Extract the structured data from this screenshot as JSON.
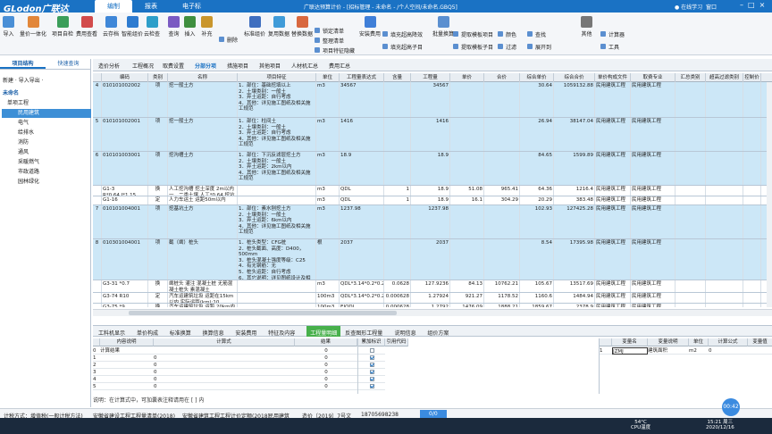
{
  "app": {
    "logo": "GLodon广联达",
    "window_title": "广联达预算计价 - [招标管理 - 未命名 - /个人空间/未命名.GBQ5]",
    "menu_tabs": [
      "编制",
      "报表",
      "电子标"
    ],
    "online_learning": "在线学习",
    "window_label": "窗口"
  },
  "ribbon": {
    "large_buttons": [
      "导入",
      "量价一体化",
      "项目自检",
      "费用查看",
      "云存档",
      "智能组价",
      "云检查",
      "查询",
      "插入",
      "补充",
      "标准组价",
      "复用数据",
      "替换数据",
      "安装费用",
      "批量换算",
      "其他",
      "工具"
    ],
    "small_buttons": [
      "删除",
      "锁定清单",
      "整理清单",
      "项目特征隐藏",
      "填充超高降效",
      "填充超高子目",
      "提取模板项目",
      "提取模板子目",
      "颜色",
      "查找",
      "过滤",
      "展开到",
      "计算器"
    ],
    "sub_menu": "标准组价"
  },
  "left_panel": {
    "tabs": [
      "项目结构",
      "快速查询"
    ],
    "toolbar": "新建 · 导入导出 ·",
    "tree": [
      "未命名",
      "单项工程",
      "民用建筑",
      "电气",
      "给排水",
      "消防",
      "通风",
      "采暖燃气",
      "市政道路",
      "园林绿化"
    ]
  },
  "main_tabs": [
    "造价分析",
    "工程概况",
    "取费设置",
    "分部分项",
    "措施项目",
    "其他项目",
    "人材机汇总",
    "费用汇总"
  ],
  "grid": {
    "headers": [
      "",
      "编码",
      "类别",
      "名称",
      "项目特征",
      "单位",
      "工程量表达式",
      "含量",
      "工程量",
      "单价",
      "合价",
      "综合单价",
      "综合合价",
      "单价构成文件",
      "取费专业",
      "汇总类别",
      "超高过滤类别",
      "控制价"
    ],
    "rows": [
      {
        "no": "4",
        "code": "010101002002",
        "type": "项",
        "name": "挖一般土方",
        "feature": "1．部位：基础挖填以上\n2．土壤类别：一般土\n3．弃土运距：自行考虑\n4．其他：详见施工图纸及相关施工规范",
        "unit": "m3",
        "expr": "34567",
        "content": "",
        "qty": "34567",
        "price": "",
        "total": "",
        "comp_price": "30.64",
        "comp_total": "1059132.88",
        "file": "民用建筑工程",
        "prof": "民用建筑工程",
        "hl": true
      },
      {
        "no": "5",
        "code": "010101002001",
        "type": "项",
        "name": "挖一般土方",
        "feature": "1．部位：柱间土\n2．土壤类别：一般土\n3．弃土运距：自行考虑\n4．其他：详见施工图纸及相关施工规范",
        "unit": "m3",
        "expr": "1416",
        "content": "",
        "qty": "1416",
        "price": "",
        "total": "",
        "comp_price": "26.94",
        "comp_total": "38147.04",
        "file": "民用建筑工程",
        "prof": "民用建筑工程",
        "hl": true
      },
      {
        "no": "6",
        "code": "010101003001",
        "type": "项",
        "name": "挖沟槽土方",
        "feature": "1．部位：下沉反滤层挖土方\n2．土壤类别：一般土\n3．弃土运距：2km以内\n4．其他：详见施工图纸及相关施工规范",
        "unit": "m3",
        "expr": "18.9",
        "content": "",
        "qty": "18.9",
        "price": "",
        "total": "",
        "comp_price": "84.65",
        "comp_total": "1599.89",
        "file": "民用建筑工程",
        "prof": "民用建筑工程",
        "hl": true
      },
      {
        "no": "",
        "code": "G1-3\nR*0.64,J*1.15",
        "type": "换",
        "name": "人工挖沟槽 挖土深度 2m以内 一、二类土壤 人工*0.64 挖坑槽土方 人工*1.5",
        "feature": "",
        "unit": "m3",
        "expr": "QDL",
        "content": "1",
        "qty": "18.9",
        "price": "51.08",
        "total": "965.41",
        "comp_price": "64.36",
        "comp_total": "1216.4",
        "file": "民用建筑工程",
        "prof": "民用建筑工程",
        "hl": false
      },
      {
        "no": "",
        "code": "G1-16",
        "type": "定",
        "name": "人力车运土 运距50m以内",
        "feature": "",
        "unit": "m3",
        "expr": "QDL",
        "content": "1",
        "qty": "18.9",
        "price": "16.1",
        "total": "304.29",
        "comp_price": "20.29",
        "comp_total": "383.48",
        "file": "民用建筑工程",
        "prof": "民用建筑工程",
        "hl": false
      },
      {
        "no": "7",
        "code": "010101004001",
        "type": "项",
        "name": "挖基坑土方",
        "feature": "1．部位：素水刨挖土方\n2．土壤类别：一般土\n3．弃土运距：6km以内\n4．其他：详见施工图纸及相关施工规范",
        "unit": "m3",
        "expr": "1237.98",
        "content": "",
        "qty": "1237.98",
        "price": "",
        "total": "",
        "comp_price": "102.93",
        "comp_total": "127425.28",
        "file": "民用建筑工程",
        "prof": "民用建筑工程",
        "hl": true
      },
      {
        "no": "8",
        "code": "010301004001",
        "type": "项",
        "name": "截（凿）桩头",
        "feature": "1．桩头类型：CFG桩\n2．桩头截面、高度：D400，500mm\n3．桩头混凝土强度等级：C25\n4．有无钢筋：无\n5．桩头运距：自行考虑\n6．其它说明：详见图纸设计及相关规范要求",
        "unit": "根",
        "expr": "2037",
        "content": "",
        "qty": "2037",
        "price": "",
        "total": "",
        "comp_price": "8.54",
        "comp_total": "17395.98",
        "file": "民用建筑工程",
        "prof": "民用建筑工程",
        "hl": true
      },
      {
        "no": "",
        "code": "G3-31 *0.7",
        "type": "换",
        "name": "凿桩头 灌注 混凝土桩 无筋混凝土桩头 素混凝土",
        "feature": "",
        "unit": "m3",
        "expr": "QDL*3.14*0.2*0.2*0.5",
        "content": "0.0628",
        "qty": "127.9236",
        "price": "84.13",
        "total": "10762.21",
        "comp_price": "105.67",
        "comp_total": "13517.69",
        "file": "民用建筑工程",
        "prof": "民用建筑工程",
        "hl": false
      },
      {
        "no": "",
        "code": "G3-74 R10",
        "type": "定",
        "name": "汽车运建筑垃圾 运距在15km以内 实际运距(km):10",
        "feature": "",
        "unit": "100m3",
        "expr": "QDL*3.14*0.2*0.2*0.5",
        "content": "0.000628",
        "qty": "1.27924",
        "price": "921.27",
        "total": "1178.52",
        "comp_price": "1160.6",
        "comp_total": "1484.94",
        "file": "民用建筑工程",
        "prof": "民用建筑工程",
        "hl": false
      },
      {
        "no": "",
        "code": "G3-75 *9",
        "type": "换",
        "name": "汽车运建筑垃圾 运距 20km内每增加运1km",
        "feature": "",
        "unit": "100m3",
        "expr": "EJQDL",
        "content": "0.000628",
        "qty": "1.2792",
        "price": "1476.09",
        "total": "1888.21",
        "comp_price": "1859.67",
        "comp_total": "2378.9",
        "file": "民用建筑工程",
        "prof": "民用建筑工程",
        "hl": false
      }
    ]
  },
  "bottom_tabs": [
    "工料机显示",
    "单价构成",
    "标准换算",
    "换算信息",
    "安装费用",
    "特征及内容",
    "工程量明细",
    "反查图形工程量",
    "说明信息",
    "组价方案"
  ],
  "bottom_active": "工程量明细",
  "detail_grid": {
    "headers": [
      "",
      "内容说明",
      "计算式",
      "结果",
      "累加标识",
      "引用代码"
    ],
    "rows": [
      {
        "idx": "0",
        "desc": "计算结果",
        "formula": "",
        "result": "0"
      },
      {
        "idx": "1",
        "desc": "",
        "formula": "0",
        "result": "0"
      },
      {
        "idx": "2",
        "desc": "",
        "formula": "0",
        "result": "0"
      },
      {
        "idx": "3",
        "desc": "",
        "formula": "0",
        "result": "0"
      },
      {
        "idx": "4",
        "desc": "",
        "formula": "0",
        "result": "0"
      },
      {
        "idx": "5",
        "desc": "",
        "formula": "0",
        "result": "0"
      }
    ]
  },
  "var_grid": {
    "headers": [
      "",
      "变量名",
      "变量说明",
      "单位",
      "计算公式",
      "变量值"
    ],
    "rows": [
      {
        "idx": "1",
        "name": "JZMJ",
        "desc": "建筑面积",
        "unit": "m2",
        "formula": "0",
        "value": ""
      }
    ]
  },
  "hint": "说明：在计算式中，可加囊表注释请用在 [ ] 内",
  "status": {
    "calc_mode": "计税方式：增值税(一般计税方法)",
    "std1": "安徽省建设工程工程量清单(2018)",
    "std2": "安徽省建筑工程工程计价定额(2018)",
    "building": "民用建筑",
    "doc": "造价〔2019〕7号文",
    "phone": "18705698238",
    "fab": "00:42"
  },
  "taskbar": {
    "temp": "54°C",
    "cpu": "CPU温度",
    "time": "15:21 周三",
    "date": "2020/12/16"
  }
}
